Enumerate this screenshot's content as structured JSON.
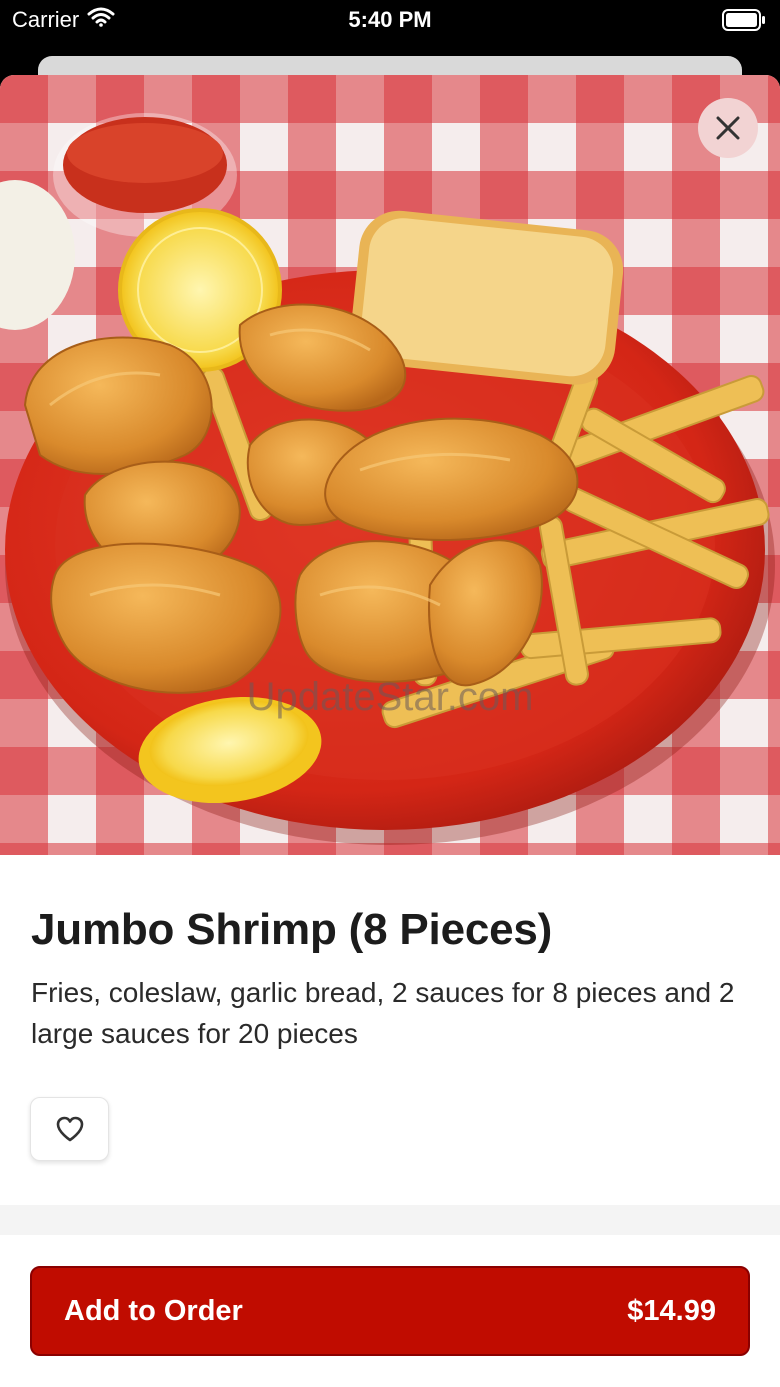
{
  "status_bar": {
    "carrier": "Carrier",
    "time": "5:40 PM"
  },
  "item": {
    "title": "Jumbo Shrimp (8 Pieces)",
    "description": "Fries, coleslaw, garlic bread, 2 sauces for 8 pieces and 2 large sauces for 20 pieces",
    "image_watermark": "UpdateStar.com"
  },
  "footer": {
    "add_label": "Add to Order",
    "price": "$14.99"
  },
  "colors": {
    "accent": "#c00c00",
    "close_bg": "#f2d3d3"
  },
  "icons": {
    "close": "close-icon",
    "favorite": "heart-icon",
    "wifi": "wifi-icon",
    "battery": "battery-icon"
  }
}
